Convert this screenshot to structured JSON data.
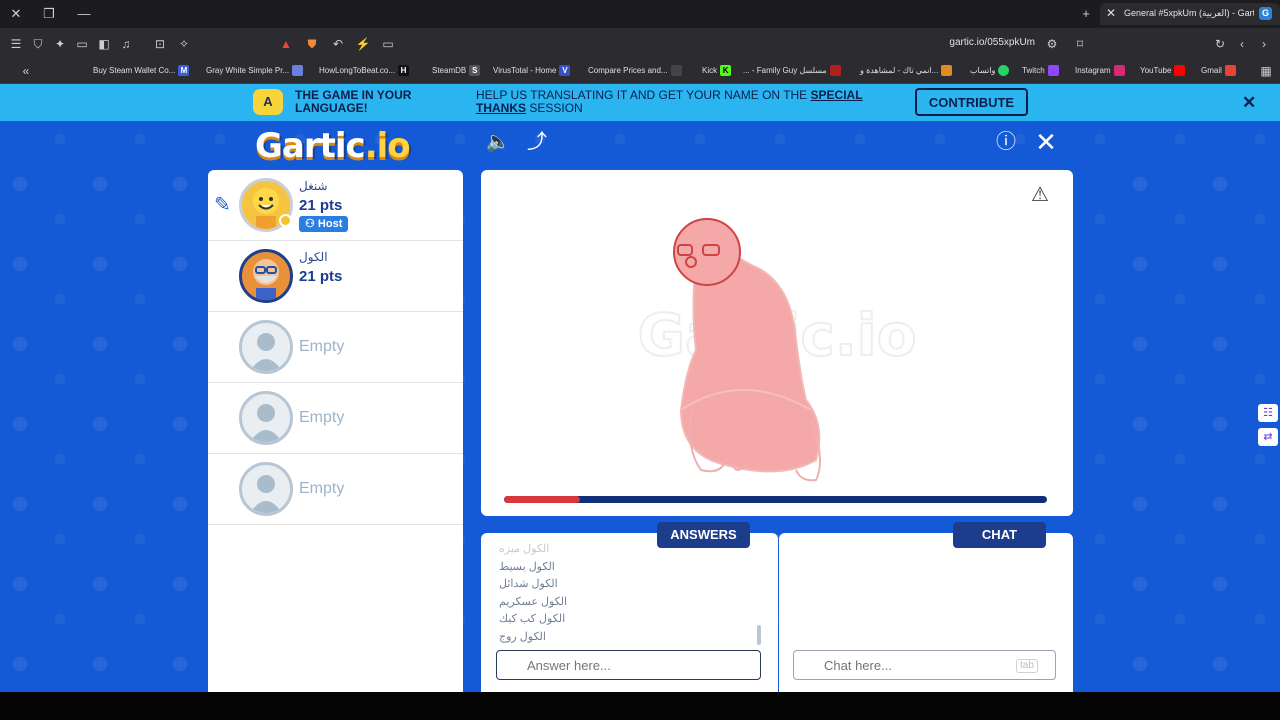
{
  "browser": {
    "tab_title": "General #5xpkUm (العربية) - Gartic",
    "tab_favicon": "G",
    "url": "gartic.io/055xpkUm",
    "bookmarks": [
      {
        "label": "Buy Steam Wallet Co...",
        "icon": "M"
      },
      {
        "label": "Gray White Simple Pr...",
        "icon": ""
      },
      {
        "label": "HowLongToBeat.co...",
        "icon": "H"
      },
      {
        "label": "SteamDB",
        "icon": "S"
      },
      {
        "label": "VirusTotal - Home",
        "icon": "V"
      },
      {
        "label": "Compare Prices and...",
        "icon": ""
      },
      {
        "label": "Kick",
        "icon": "K"
      },
      {
        "label": "... - Family Guy مسلسل",
        "icon": ""
      },
      {
        "label": "انمي تاك - لمشاهدة و...",
        "icon": ""
      },
      {
        "label": "واتساب",
        "icon": ""
      },
      {
        "label": "Twitch",
        "icon": ""
      },
      {
        "label": "Instagram",
        "icon": ""
      },
      {
        "label": "YouTube",
        "icon": ""
      },
      {
        "label": "Gmail",
        "icon": ""
      }
    ]
  },
  "banner": {
    "badge": "A",
    "left_text": "THE GAME IN YOUR LANGUAGE!",
    "mid_text": "HELP US TRANSLATING IT AND GET YOUR NAME ON THE",
    "mid_link": "SPECIAL THANKS",
    "mid_suffix": "SESSION",
    "button": "CONTRIBUTE"
  },
  "header": {
    "logo_main": "Gartic",
    "logo_suffix": ".io"
  },
  "players": [
    {
      "name": "شنغل",
      "points": "21 pts",
      "host_label": "Host",
      "is_drawing": true
    },
    {
      "name": "الكول",
      "points": "21 pts",
      "host_label": "",
      "is_drawing": false
    },
    {
      "name": "",
      "points": "",
      "empty_label": "Empty"
    },
    {
      "name": "",
      "points": "",
      "empty_label": "Empty"
    },
    {
      "name": "",
      "points": "",
      "empty_label": "Empty"
    }
  ],
  "canvas": {
    "progress_fraction": 0.14,
    "progress_color": "#d9383a",
    "track_color": "#0f2f78"
  },
  "answers": {
    "tab_label": "ANSWERS",
    "items": [
      "الكول ميزه",
      "الكول بسيط",
      "الكول شدائل",
      "الكول عسكريم",
      "الكول كب كيك",
      "الكول روج"
    ],
    "placeholder": "Answer here..."
  },
  "chat": {
    "tab_label": "CHAT",
    "placeholder": "Chat here...",
    "shortcut": "tab"
  },
  "colors": {
    "page_bg": "#1459d6",
    "banner_bg": "#2ab5f0",
    "accent_dark": "#1c3c8c"
  }
}
